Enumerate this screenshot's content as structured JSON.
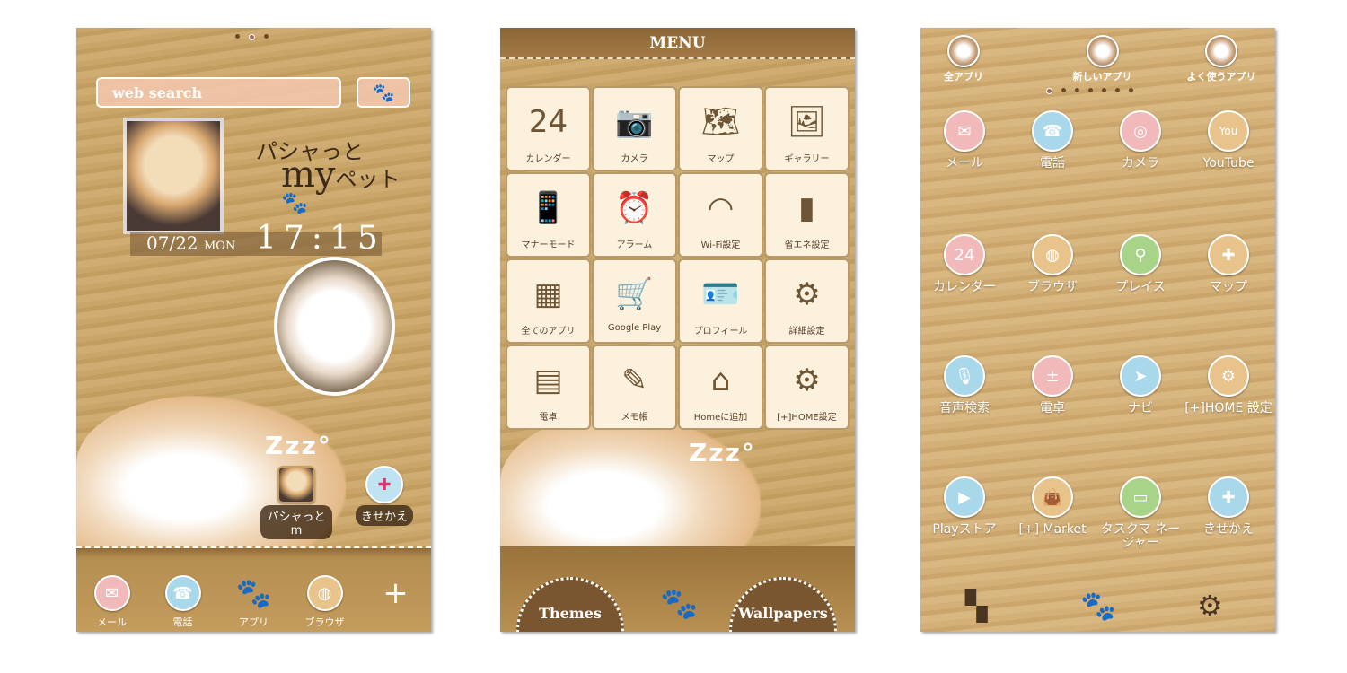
{
  "screen1": {
    "page_dots": 3,
    "active_dot": 1,
    "search_placeholder": "web search",
    "search_button_icon": "paw-icon",
    "title_line1": "パシャっと",
    "title_line2_a": "my",
    "title_line2_b": "ペット",
    "date": "07/22",
    "weekday": "MON",
    "time": "17:15",
    "zzz": "Zzz°",
    "shortcuts": [
      {
        "label": "パシャっとm",
        "icon": "dog-photo-icon"
      },
      {
        "label": "きせかえ",
        "icon": "kisekae-icon"
      }
    ],
    "dock": [
      {
        "label": "メール",
        "icon": "mail-icon",
        "color": "#f1b9b9"
      },
      {
        "label": "電話",
        "icon": "phone-icon",
        "color": "#a9d8ea"
      },
      {
        "label": "アプリ",
        "icon": "paw-icon"
      },
      {
        "label": "ブラウザ",
        "icon": "globe-icon",
        "color": "#e8c48c"
      },
      {
        "label": "",
        "icon": "plus-icon"
      }
    ]
  },
  "screen2": {
    "title": "MENU",
    "items": [
      {
        "label": "カレンダー",
        "icon": "calendar-icon",
        "glyph": "24"
      },
      {
        "label": "カメラ",
        "icon": "camera-icon",
        "glyph": "📷"
      },
      {
        "label": "マップ",
        "icon": "map-icon",
        "glyph": "🗺"
      },
      {
        "label": "ギャラリー",
        "icon": "gallery-icon",
        "glyph": "🖼"
      },
      {
        "label": "マナーモード",
        "icon": "manner-mode-icon",
        "glyph": "📱"
      },
      {
        "label": "アラーム",
        "icon": "alarm-icon",
        "glyph": "⏰"
      },
      {
        "label": "Wi-Fi設定",
        "icon": "wifi-icon",
        "glyph": "◠"
      },
      {
        "label": "省エネ設定",
        "icon": "battery-icon",
        "glyph": "▮"
      },
      {
        "label": "全てのアプリ",
        "icon": "all-apps-icon",
        "glyph": "▦"
      },
      {
        "label": "Google Play",
        "icon": "cart-icon",
        "glyph": "🛒"
      },
      {
        "label": "プロフィール",
        "icon": "profile-icon",
        "glyph": "🪪"
      },
      {
        "label": "詳細設定",
        "icon": "gear-icon",
        "glyph": "⚙"
      },
      {
        "label": "電卓",
        "icon": "calculator-icon",
        "glyph": "▤"
      },
      {
        "label": "メモ帳",
        "icon": "memo-icon",
        "glyph": "✎"
      },
      {
        "label": "Homeに追加",
        "icon": "home-add-icon",
        "glyph": "⌂"
      },
      {
        "label": "[+]HOME設定",
        "icon": "home-settings-icon",
        "glyph": "⚙"
      }
    ],
    "zzz": "Zzz°",
    "themes": "Themes",
    "wallpapers": "Wallpapers",
    "center_icon": "paw-icon"
  },
  "screen3": {
    "tabs": [
      {
        "label": "全アプリ"
      },
      {
        "label": "新しいアプリ"
      },
      {
        "label": "よく使うアプリ"
      }
    ],
    "page_dots": 7,
    "active_dot": 0,
    "apps": [
      {
        "label": "メール",
        "icon": "mail-icon",
        "color": "#f1b9b9",
        "glyph": "✉"
      },
      {
        "label": "電話",
        "icon": "phone-icon",
        "color": "#a9d8ea",
        "glyph": "☎"
      },
      {
        "label": "カメラ",
        "icon": "camera-icon",
        "color": "#f1b9b9",
        "glyph": "◎"
      },
      {
        "label": "YouTube",
        "icon": "youtube-icon",
        "color": "#e8c48c",
        "glyph": "You"
      },
      {
        "label": "カレンダー",
        "icon": "calendar-icon",
        "color": "#f1b9b9",
        "glyph": "24"
      },
      {
        "label": "ブラウザ",
        "icon": "globe-icon",
        "color": "#e8c48c",
        "glyph": "◍"
      },
      {
        "label": "プレイス",
        "icon": "place-pin-icon",
        "color": "#a8d48a",
        "glyph": "⚲"
      },
      {
        "label": "マップ",
        "icon": "map-icon",
        "color": "#e8c48c",
        "glyph": "✚"
      },
      {
        "label": "音声検索",
        "icon": "microphone-icon",
        "color": "#a9d8ea",
        "glyph": "🎙"
      },
      {
        "label": "電卓",
        "icon": "calculator-icon",
        "color": "#f1b9b9",
        "glyph": "±"
      },
      {
        "label": "ナビ",
        "icon": "navigation-icon",
        "color": "#a9d8ea",
        "glyph": "➤"
      },
      {
        "label": "[+]HOME 設定",
        "icon": "home-settings-icon",
        "color": "#e8c48c",
        "glyph": "⚙"
      },
      {
        "label": "Playストア",
        "icon": "play-store-icon",
        "color": "#a9d8ea",
        "glyph": "▶"
      },
      {
        "label": "[+] Market",
        "icon": "market-bag-icon",
        "color": "#e8c48c",
        "glyph": "👜"
      },
      {
        "label": "タスクマ ネージャー",
        "icon": "task-manager-icon",
        "color": "#a8d48a",
        "glyph": "▭"
      },
      {
        "label": "きせかえ",
        "icon": "kisekae-icon",
        "color": "#a9d8ea",
        "glyph": "✚"
      }
    ],
    "bottom": [
      {
        "icon": "widgets-icon",
        "glyph": "▚"
      },
      {
        "icon": "paw-icon",
        "glyph": "🐾"
      },
      {
        "icon": "gear-icon",
        "glyph": "⚙"
      }
    ]
  }
}
